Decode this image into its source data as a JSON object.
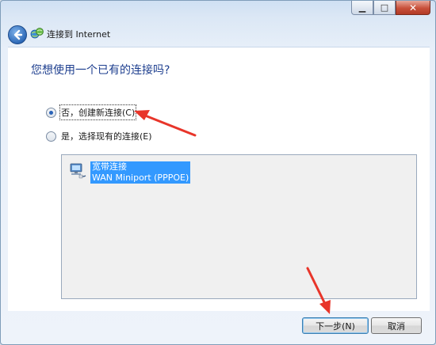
{
  "window": {
    "title": "连接到 Internet",
    "controls": [
      "minimize",
      "maximize",
      "close"
    ]
  },
  "heading": "您想使用一个已有的连接吗?",
  "options": [
    {
      "label": "否，创建新连接(C)",
      "selected": true
    },
    {
      "label": "是，选择现有的连接(E)",
      "selected": false
    }
  ],
  "connection_list": {
    "items": [
      {
        "name": "宽带连接",
        "device": "WAN Miniport (PPPOE)",
        "selected": true
      }
    ]
  },
  "buttons": {
    "next": "下一步(N)",
    "cancel": "取消"
  },
  "colors": {
    "heading": "#1e3f8f",
    "selection": "#3399ff",
    "annotation_arrow": "#e8352a"
  },
  "icons": {
    "back": "back-arrow-icon",
    "app": "network-globe-icon",
    "connection": "network-computer-icon"
  }
}
